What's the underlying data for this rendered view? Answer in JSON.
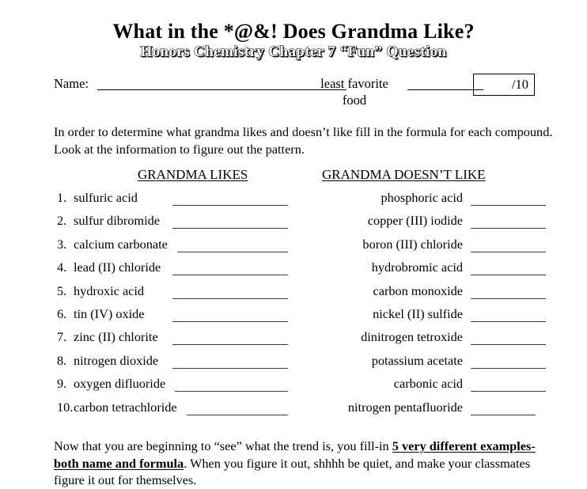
{
  "document": {
    "title_main": "What in the *@&! Does Grandma Like?",
    "title_sub": "Honors Chemistry Chapter 7 “Fun” Question",
    "name_label": "Name:",
    "least_favorite_label": "least favorite\nfood",
    "score_text": "/10",
    "intro": "In order to determine what grandma likes and doesn’t like fill in the formula for each compound. Look at the information to figure out the pattern.",
    "footer_part1": "Now that you are beginning to “see” what the trend is, you fill-in ",
    "footer_bold": "5 very different examples-both name and formula",
    "footer_part2": ".  When you figure it out, shhhh be quiet, and make your classmates figure it out for themselves."
  },
  "columns": {
    "left_header": "GRANDMA LIKES",
    "right_header": "GRANDMA DOESN’T LIKE"
  },
  "likes": [
    {
      "num": "1.",
      "name": "sulfuric acid"
    },
    {
      "num": "2.",
      "name": "sulfur dibromide"
    },
    {
      "num": "3.",
      "name": "calcium carbonate"
    },
    {
      "num": "4.",
      "name": "lead (II) chloride"
    },
    {
      "num": "5.",
      "name": "hydroxic acid"
    },
    {
      "num": "6.",
      "name": "tin (IV) oxide"
    },
    {
      "num": "7.",
      "name": "zinc (II) chlorite"
    },
    {
      "num": "8.",
      "name": "nitrogen dioxide"
    },
    {
      "num": "9.",
      "name": "oxygen difluoride"
    },
    {
      "num": "10.",
      "name": "carbon tetrachloride"
    }
  ],
  "dislikes": [
    {
      "name": "phosphoric acid"
    },
    {
      "name": "copper (III) iodide"
    },
    {
      "name": "boron (III) chloride"
    },
    {
      "name": "hydrobromic acid"
    },
    {
      "name": "carbon monoxide"
    },
    {
      "name": "nickel (II) sulfide"
    },
    {
      "name": "dinitrogen tetroxide"
    },
    {
      "name": "potassium acetate"
    },
    {
      "name": "carbonic acid"
    },
    {
      "name": "nitrogen pentafluoride"
    }
  ]
}
